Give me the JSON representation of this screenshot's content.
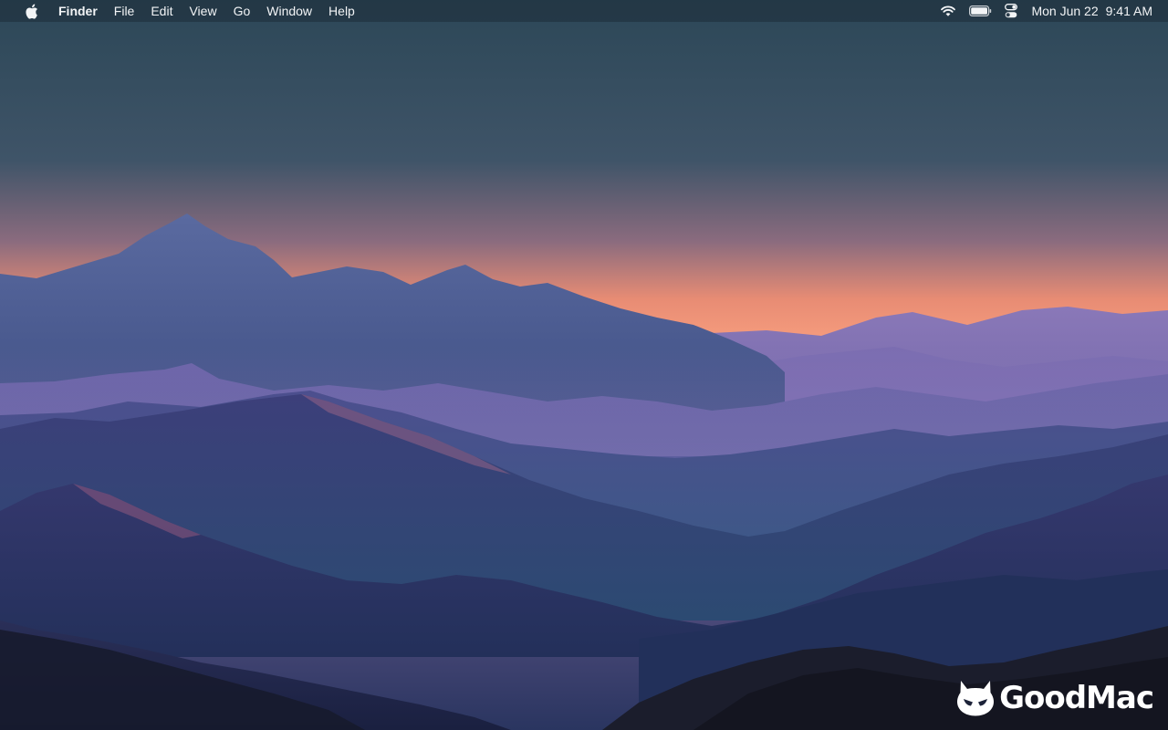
{
  "menubar": {
    "apple_icon": "apple-logo-icon",
    "app_name": "Finder",
    "menus": [
      "File",
      "Edit",
      "View",
      "Go",
      "Window",
      "Help"
    ],
    "status_icons": [
      "wifi-icon",
      "battery-icon",
      "control-center-icon"
    ],
    "date": "Mon Jun 22",
    "time": "9:41 AM"
  },
  "watermark": {
    "text": "GoodMac",
    "logo_icon": "devil-face-logo-icon"
  },
  "colors": {
    "sky_top": "#2f4a5a",
    "horizon_glow": "#f39477",
    "mountain_purple": "#6a5a9a",
    "mountain_blue": "#2f4a7a",
    "foreground_dark": "#1a2036"
  }
}
